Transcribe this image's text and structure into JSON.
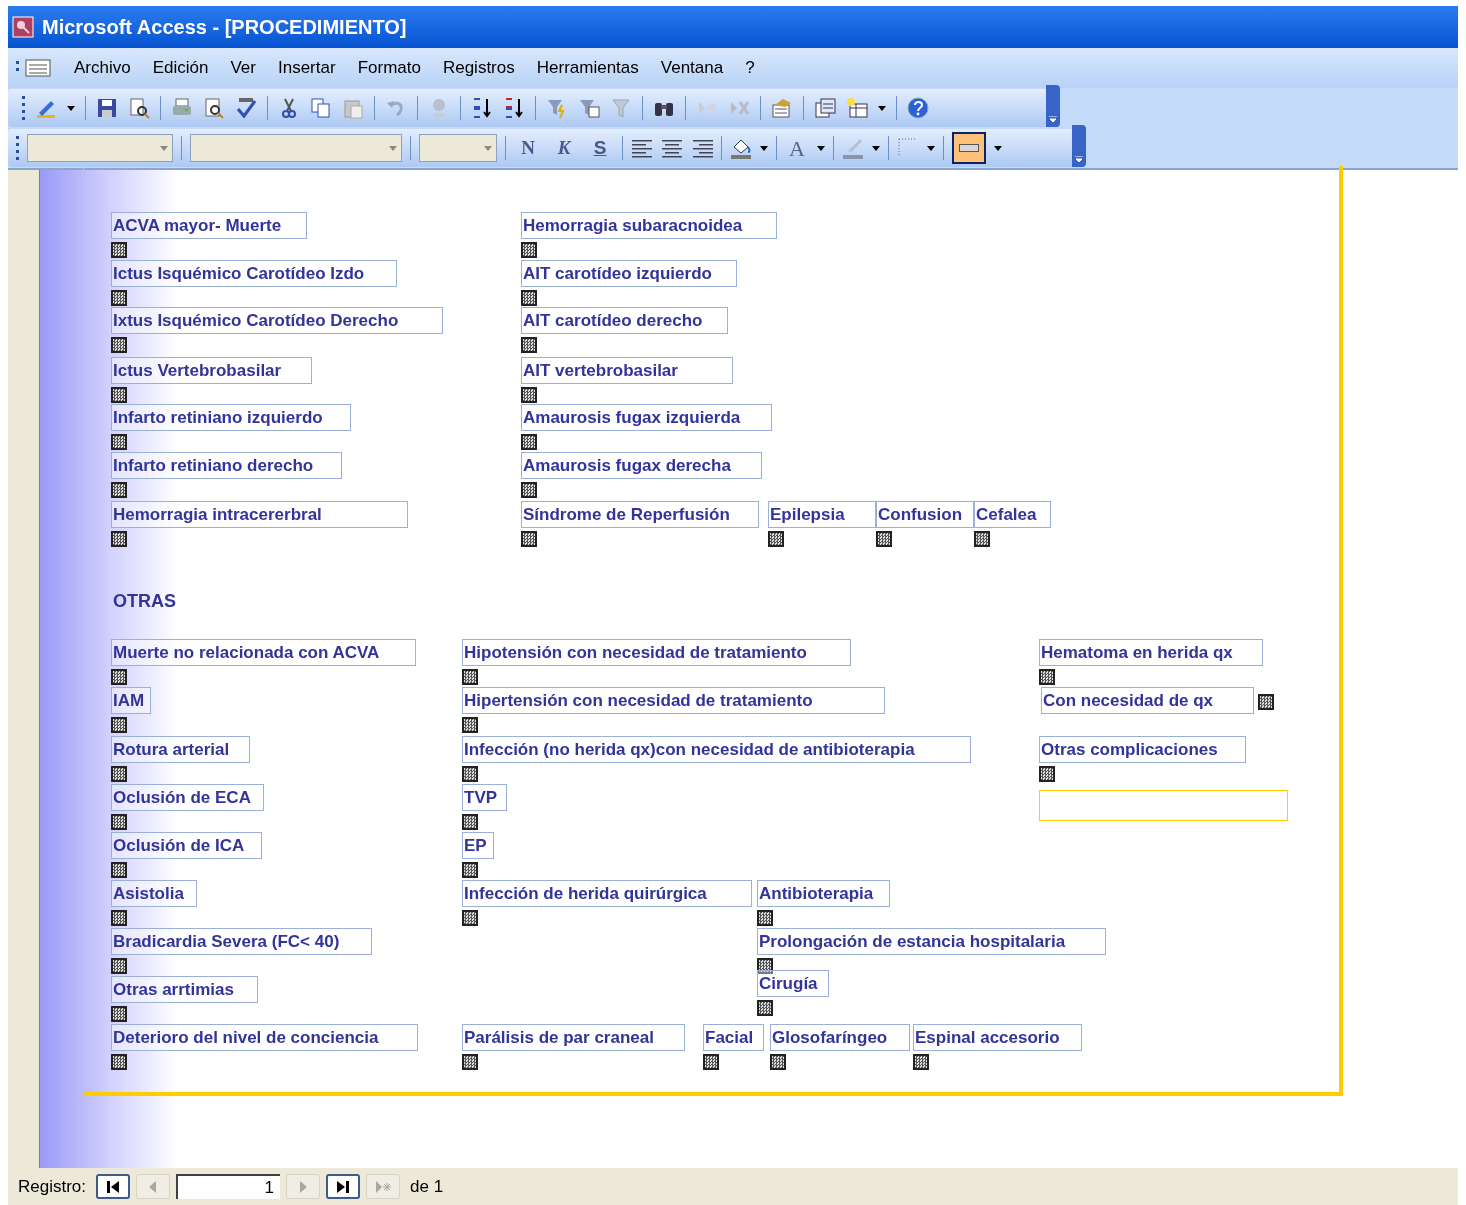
{
  "window": {
    "title": "Microsoft Access - [PROCEDIMIENTO]"
  },
  "menu": [
    "Archivo",
    "Edición",
    "Ver",
    "Insertar",
    "Formato",
    "Registros",
    "Herramientas",
    "Ventana",
    "?"
  ],
  "formatting": {
    "bold": "N",
    "italic": "K",
    "underline": "S",
    "font_color": "A"
  },
  "complications": [
    {
      "label": "ACVA mayor- Muerte",
      "indeterminate": true
    },
    {
      "label": "Ictus Isquémico Carotídeo Izdo",
      "indeterminate": true
    },
    {
      "label": "Ixtus Isquémico Carotídeo Derecho",
      "indeterminate": true
    },
    {
      "label": "Ictus Vertebrobasilar",
      "indeterminate": true
    },
    {
      "label": "Infarto retiniano izquierdo",
      "indeterminate": true
    },
    {
      "label": "Infarto retiniano derecho",
      "indeterminate": true
    },
    {
      "label": "Hemorragia intracererbral",
      "indeterminate": true
    },
    {
      "label": "Hemorragia subaracnoidea",
      "indeterminate": true
    },
    {
      "label": "AIT carotídeo izquierdo",
      "indeterminate": true
    },
    {
      "label": "AIT carotídeo derecho",
      "indeterminate": true
    },
    {
      "label": "AIT vertebrobasilar",
      "indeterminate": true
    },
    {
      "label": "Amaurosis fugax izquierda",
      "indeterminate": true
    },
    {
      "label": "Amaurosis fugax derecha",
      "indeterminate": true
    },
    {
      "label": "Síndrome de Reperfusión",
      "indeterminate": true
    },
    {
      "label": "Epilepsia",
      "indeterminate": true
    },
    {
      "label": "Confusion",
      "indeterminate": true
    },
    {
      "label": "Cefalea",
      "indeterminate": true
    }
  ],
  "section_heading": "OTRAS",
  "others": [
    {
      "label": "Muerte no relacionada con ACVA",
      "indeterminate": true
    },
    {
      "label": "IAM",
      "indeterminate": true
    },
    {
      "label": "Rotura arterial",
      "indeterminate": true
    },
    {
      "label": "Oclusión de ECA",
      "indeterminate": true
    },
    {
      "label": "Oclusión de ICA",
      "indeterminate": true
    },
    {
      "label": "Asistolia",
      "indeterminate": true
    },
    {
      "label": "Bradicardia Severa (FC< 40)",
      "indeterminate": true
    },
    {
      "label": "Otras arrtimias",
      "indeterminate": true
    },
    {
      "label": "Deterioro del nivel de conciencia",
      "indeterminate": true
    },
    {
      "label": "Hipotensión con necesidad de tratamiento",
      "indeterminate": true
    },
    {
      "label": "Hipertensión con necesidad de tratamiento",
      "indeterminate": true
    },
    {
      "label": "Infección (no herida qx)con necesidad de antibioterapia",
      "indeterminate": true
    },
    {
      "label": "TVP",
      "indeterminate": true
    },
    {
      "label": "EP",
      "indeterminate": true
    },
    {
      "label": "Infección de herida quirúrgica",
      "indeterminate": true
    },
    {
      "label": "Antibioterapia",
      "indeterminate": true
    },
    {
      "label": "Prolongación de estancia hospitalaria",
      "indeterminate": true
    },
    {
      "label": "Cirugía",
      "indeterminate": true
    },
    {
      "label": "Parálisis de par craneal",
      "indeterminate": true
    },
    {
      "label": "Facial",
      "indeterminate": true
    },
    {
      "label": "Glosofaríngeo",
      "indeterminate": true
    },
    {
      "label": "Espinal accesorio",
      "indeterminate": true
    },
    {
      "label": "Hematoma en herida qx",
      "indeterminate": true
    },
    {
      "label": "Con necesidad de qx",
      "indeterminate": true
    },
    {
      "label": "Otras complicaciones",
      "indeterminate": true
    }
  ],
  "navigation": {
    "label": "Registro:",
    "record": "1",
    "total": "de 1"
  }
}
